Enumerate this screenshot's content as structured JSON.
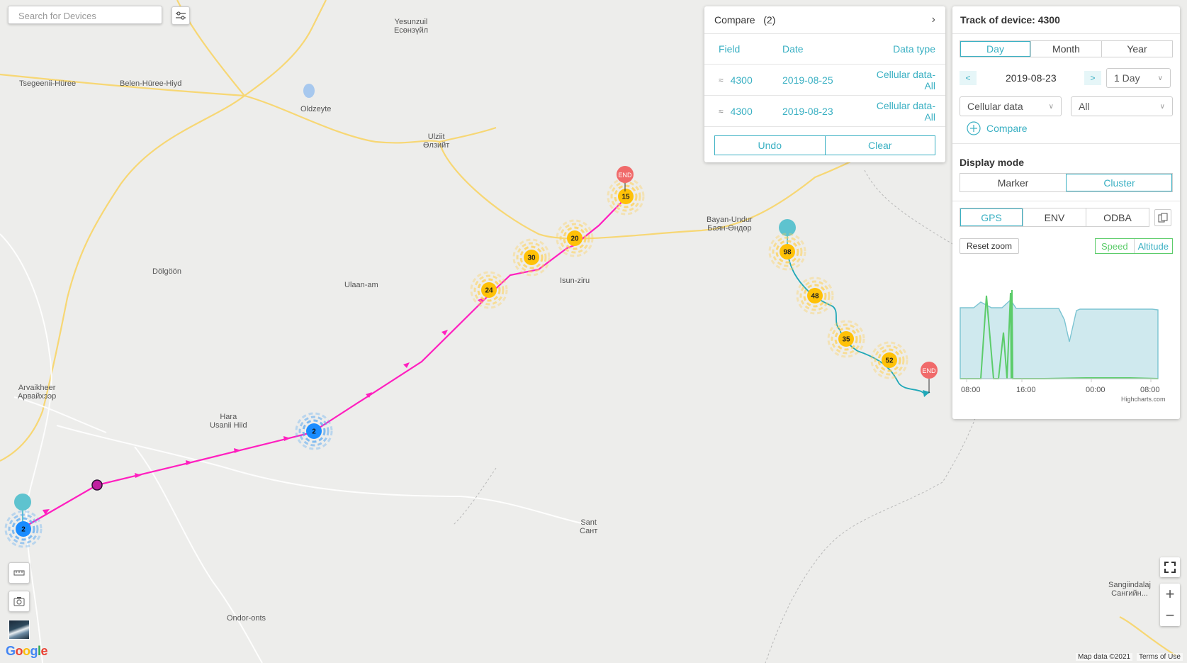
{
  "search": {
    "placeholder": "Search for Devices"
  },
  "places": [
    {
      "label": "Yesunzuil\nЕсөнзүйл"
    },
    {
      "label": "Tsegeenii-Hüree"
    },
    {
      "label": "Belen-Hüree-Hiyd"
    },
    {
      "label": "Oldzeyte"
    },
    {
      "label": "Ulziit\nӨлзийт"
    },
    {
      "label": "Dölgöön"
    },
    {
      "label": "Ulaan-am"
    },
    {
      "label": "Isun-ziru"
    },
    {
      "label": "Bayan-Undur\nБаян-Өндөр"
    },
    {
      "label": "Arvaikheer\nАрвайхээр"
    },
    {
      "label": "Hara\nUsanii Hiid"
    },
    {
      "label": "Sant\nСант"
    },
    {
      "label": "Ondor-onts"
    },
    {
      "label": "Sangiindalaj\nСангийн..."
    }
  ],
  "track1_clusters": [
    "2",
    "2"
  ],
  "track1_yellow": [
    "24",
    "30",
    "20",
    "15"
  ],
  "track2_yellow": [
    "98",
    "48",
    "35",
    "52"
  ],
  "end_label": "END",
  "compare": {
    "title": "Compare",
    "count": "(2)",
    "columns": [
      "Field",
      "Date",
      "Data type"
    ],
    "rows": [
      {
        "field": "4300",
        "date": "2019-08-25",
        "type": "Cellular data-All"
      },
      {
        "field": "4300",
        "date": "2019-08-23",
        "type": "Cellular data-All"
      }
    ],
    "undo": "Undo",
    "clear": "Clear"
  },
  "track": {
    "title": "Track of device: 4300",
    "periods": [
      "Day",
      "Month",
      "Year"
    ],
    "prev": "<",
    "next": ">",
    "date": "2019-08-23",
    "range": "1 Day",
    "datatype": "Cellular data",
    "filter": "All",
    "compare_label": "Compare",
    "display_mode_label": "Display mode",
    "display_modes": [
      "Marker",
      "Cluster"
    ],
    "sensor_tabs": [
      "GPS",
      "ENV",
      "ODBA"
    ],
    "reset_zoom": "Reset zoom",
    "metric_tabs": [
      "Speed",
      "Altitude"
    ],
    "x_ticks": [
      "08:00",
      "16:00",
      "00:00",
      "08:00"
    ],
    "credit": "Highcharts.com"
  },
  "chart_data": {
    "type": "area",
    "x_ticks": [
      "08:00",
      "16:00",
      "00:00",
      "08:00"
    ],
    "series": [
      {
        "name": "Altitude",
        "color": "#a8d8e0"
      },
      {
        "name": "Speed",
        "color": "#5ccc6a"
      }
    ]
  },
  "footer": {
    "map_data": "Map data ©2021",
    "terms": "Terms of Use",
    "google": "Google"
  },
  "colors": {
    "accent": "#3ab0c3",
    "track1": "#ff1fbf",
    "track2": "#20a8b8",
    "cluster_blue": "#1a8cff",
    "cluster_yellow": "#ffc107",
    "end_red": "#f06a6a"
  }
}
